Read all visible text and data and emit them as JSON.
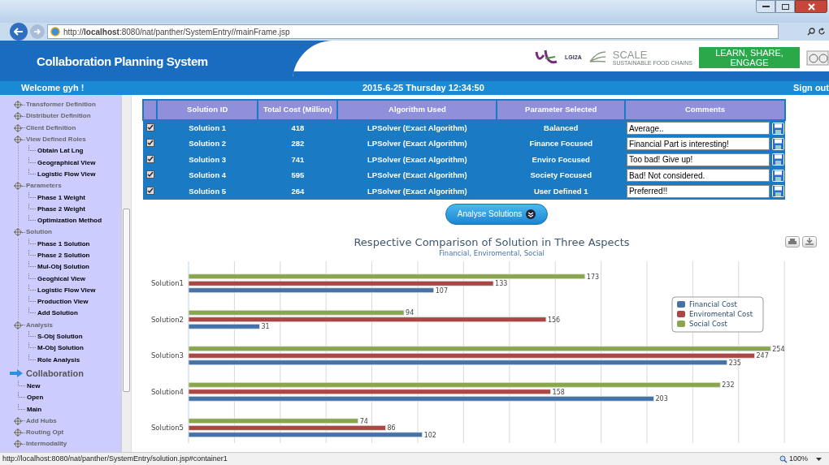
{
  "browser": {
    "url": "http://**localhost**:8080/nat/panther/SystemEntry//mainFrame.jsp"
  },
  "header": {
    "title": "Collaboration Planning System",
    "lgi2a": "LGI2A",
    "scale": "SCALE",
    "scale_tagline": "SUSTAINABLE FOOD CHAINS",
    "banner": "LEARN, SHARE, ENGAGE"
  },
  "welcome_bar": {
    "greeting": "Welcome gyh !",
    "datetime": "2015-6-25 Thursday 12:34:50",
    "sign_out": "Sign out"
  },
  "sidebar": {
    "items": [
      {
        "kind": "folder",
        "label": "Transformer Definition"
      },
      {
        "kind": "folder",
        "label": "Distributer Definition"
      },
      {
        "kind": "folder",
        "label": "Client Definition"
      },
      {
        "kind": "folder",
        "label": "View Defined Roles",
        "children": [
          {
            "kind": "leaf",
            "label": "Obtain Lat Lng"
          },
          {
            "kind": "leaf",
            "label": "Geographical View"
          },
          {
            "kind": "leaf",
            "label": "Logistic Flow View"
          }
        ]
      },
      {
        "kind": "folder",
        "label": "Parameters",
        "children": [
          {
            "kind": "leaf",
            "label": "Phase 1 Weight"
          },
          {
            "kind": "leaf",
            "label": "Phase 2 Weight"
          },
          {
            "kind": "leaf",
            "label": "Optimization Method"
          }
        ]
      },
      {
        "kind": "folder",
        "label": "Solution",
        "children": [
          {
            "kind": "leaf",
            "label": "Phase 1 Solution"
          },
          {
            "kind": "leaf",
            "label": "Phase 2 Solution"
          },
          {
            "kind": "leaf",
            "label": "Mul-Obj Solution"
          },
          {
            "kind": "leaf",
            "label": "Geoghical View"
          },
          {
            "kind": "leaf",
            "label": "Logistic Flow View"
          },
          {
            "kind": "leaf",
            "label": "Production View"
          },
          {
            "kind": "leaf",
            "label": "Add Solution"
          }
        ]
      },
      {
        "kind": "folder",
        "label": "Analysis",
        "children": [
          {
            "kind": "leaf",
            "label": "S-Obj Solution"
          },
          {
            "kind": "leaf",
            "label": "M-Obj Solution"
          },
          {
            "kind": "leaf",
            "label": "Role Analysis"
          }
        ]
      },
      {
        "kind": "heading",
        "label": "Collaboration",
        "children": [
          {
            "kind": "leaf",
            "label": "New"
          },
          {
            "kind": "leaf",
            "label": "Open"
          },
          {
            "kind": "leaf",
            "label": "Main"
          },
          {
            "kind": "folder",
            "label": "Add Hubs"
          },
          {
            "kind": "folder",
            "label": "Routing Opt"
          },
          {
            "kind": "folder",
            "label": "Intermodality"
          }
        ]
      }
    ]
  },
  "table": {
    "columns": [
      "Solution ID",
      "Total Cost (Million)",
      "Algorithm Used",
      "Parameter Selected",
      "Comments"
    ],
    "rows": [
      {
        "checked": true,
        "solution": "Solution 1",
        "cost": "418",
        "algorithm": "LPSolver (Exact Algorithm)",
        "parameter": "Balanced",
        "comment": "Average.."
      },
      {
        "checked": true,
        "solution": "Solution 2",
        "cost": "282",
        "algorithm": "LPSolver (Exact Algorithm)",
        "parameter": "Finance Focused",
        "comment": "Financial Part is interesting!"
      },
      {
        "checked": true,
        "solution": "Solution 3",
        "cost": "741",
        "algorithm": "LPSolver (Exact Algorithm)",
        "parameter": "Enviro Focused",
        "comment": "Too bad! Give up!"
      },
      {
        "checked": true,
        "solution": "Solution 4",
        "cost": "595",
        "algorithm": "LPSolver (Exact Algorithm)",
        "parameter": "Society Focused",
        "comment": "Bad! Not considered."
      },
      {
        "checked": true,
        "solution": "Solution 5",
        "cost": "264",
        "algorithm": "LPSolver (Exact Algorithm)",
        "parameter": "User Defined 1",
        "comment": "Preferred!!"
      }
    ]
  },
  "analyse_button": "Analyse Solutions",
  "chart": {
    "subtitle": "Financial, Enviromental, Social",
    "chart_data": {
      "type": "bar",
      "orientation": "horizontal",
      "title": "Respective Comparison of Solution in Three Aspects",
      "categories": [
        "Solution1",
        "Solution2",
        "Solution3",
        "Solution4",
        "Solution5"
      ],
      "data_labels": true,
      "legend": true,
      "series": [
        {
          "name": "Financial Cost",
          "color": "#4572a7",
          "values": [
            107,
            31,
            235,
            203,
            102
          ]
        },
        {
          "name": "Enviromental Cost",
          "color": "#aa4643",
          "values": [
            133,
            156,
            247,
            158,
            86
          ]
        },
        {
          "name": "Social Cost",
          "color": "#89a54e",
          "values": [
            173,
            94,
            254,
            232,
            74
          ]
        }
      ]
    }
  },
  "status_bar": {
    "url": "http://localhost:8080/nat/panther/SystemEntry/solution.jsp#container1",
    "zoom": "100%"
  }
}
